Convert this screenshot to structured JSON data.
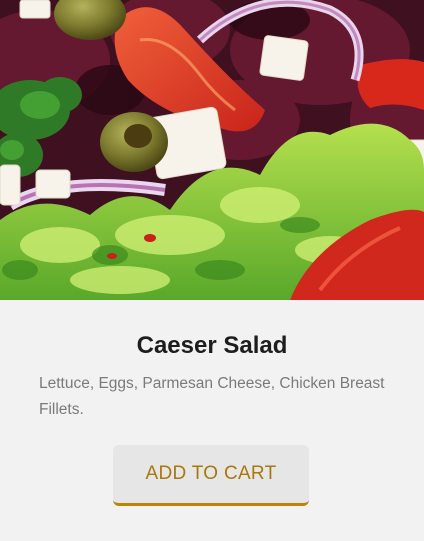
{
  "product": {
    "image_alt": "salad-photo",
    "title": "Caeser Salad",
    "description": "Lettuce, Eggs, Parmesan Cheese, Chicken Breast Fillets.",
    "button_label": "ADD TO CART"
  },
  "colors": {
    "background": "#f2f2f2",
    "title": "#1d1d1d",
    "description": "#7a7a7a",
    "button_bg": "#e6e6e6",
    "button_text": "#a8780c",
    "button_accent": "#b8860b"
  }
}
